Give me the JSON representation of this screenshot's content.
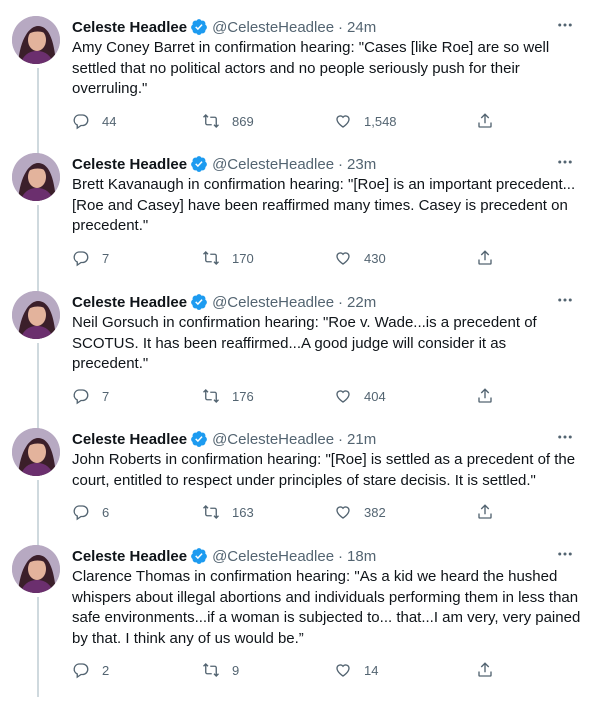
{
  "author": {
    "name": "Celeste Headlee",
    "handle": "@CelesteHeadlee",
    "separator": "·"
  },
  "colors": {
    "text": "#0f1419",
    "secondary": "#536471",
    "verified": "#1d9bf0",
    "thread_line": "#cfd9de"
  },
  "icons": {
    "verified": "verified-badge-icon",
    "more": "more-dots-icon",
    "reply": "reply-icon",
    "retweet": "retweet-icon",
    "like": "heart-icon",
    "share": "share-icon"
  },
  "tweets": [
    {
      "time": "24m",
      "text": "Amy Coney Barret in confirmation hearing: \"Cases [like Roe] are so well settled that no political actors and no people seriously push for their overruling.\"",
      "replies": "44",
      "retweets": "869",
      "likes": "1,548"
    },
    {
      "time": "23m",
      "text": "Brett Kavanaugh in confirmation hearing: \"[Roe] is an important precedent... [Roe and Casey] have been reaffirmed many times. Casey is precedent on precedent.\"",
      "replies": "7",
      "retweets": "170",
      "likes": "430"
    },
    {
      "time": "22m",
      "text": "Neil Gorsuch in confirmation hearing: \"Roe v. Wade...is a precedent of SCOTUS. It has been reaffirmed...A good judge will consider it as precedent.\"",
      "replies": "7",
      "retweets": "176",
      "likes": "404"
    },
    {
      "time": "21m",
      "text": "John Roberts in confirmation hearing: \"[Roe] is settled as a precedent of the court, entitled to respect under principles of stare decisis. It is settled.\"",
      "replies": "6",
      "retweets": "163",
      "likes": "382"
    },
    {
      "time": "18m",
      "text": "Clarence Thomas in confirmation hearing: \"As a kid we heard the hushed whispers about illegal abortions and individuals performing them in less than safe environments...if a woman is subjected to... that...I am very, very pained by that. I think any of us would be.”",
      "replies": "2",
      "retweets": "9",
      "likes": "14"
    }
  ]
}
